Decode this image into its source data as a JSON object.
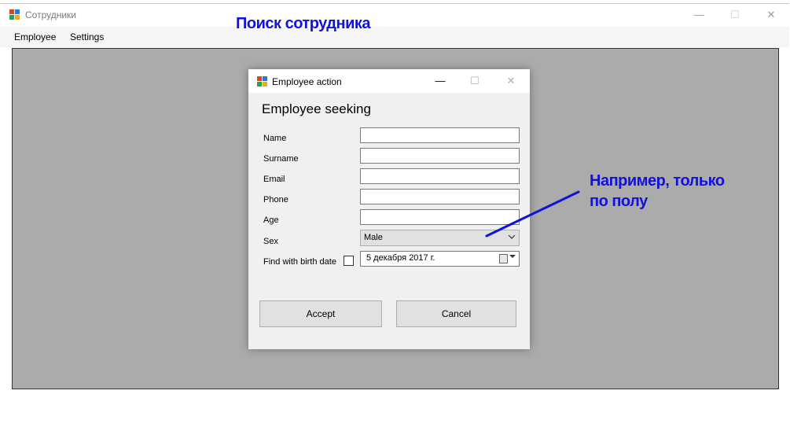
{
  "main_window": {
    "title": "Сотрудники",
    "controls": {
      "minimize": "—",
      "maximize": "☐",
      "close": "✕"
    }
  },
  "menu": {
    "items": [
      "Employee",
      "Settings"
    ]
  },
  "annotation_title": "Поиск сотрудника",
  "dialog": {
    "title": "Employee action",
    "controls": {
      "minimize": "—",
      "maximize": "☐",
      "close": "✕"
    },
    "heading": "Employee seeking",
    "fields": {
      "name": {
        "label": "Name",
        "value": ""
      },
      "surname": {
        "label": "Surname",
        "value": ""
      },
      "email": {
        "label": "Email",
        "value": ""
      },
      "phone": {
        "label": "Phone",
        "value": ""
      },
      "age": {
        "label": "Age",
        "value": ""
      },
      "sex": {
        "label": "Sex",
        "value": "Male"
      },
      "birth_date": {
        "label": "Find with birth date",
        "checked": false,
        "value": "5  декабря   2017 г."
      }
    },
    "buttons": {
      "accept": "Accept",
      "cancel": "Cancel"
    }
  },
  "annotation_note": {
    "line1": "Например, только",
    "line2": "по полу"
  },
  "colors": {
    "annotation": "#1010e0",
    "mdi_background": "#ababab",
    "dialog_background": "#f0f0f0"
  },
  "icons": {
    "app": "app-icon",
    "calendar": "calendar-icon",
    "dropdown": "chevron-down-icon"
  }
}
